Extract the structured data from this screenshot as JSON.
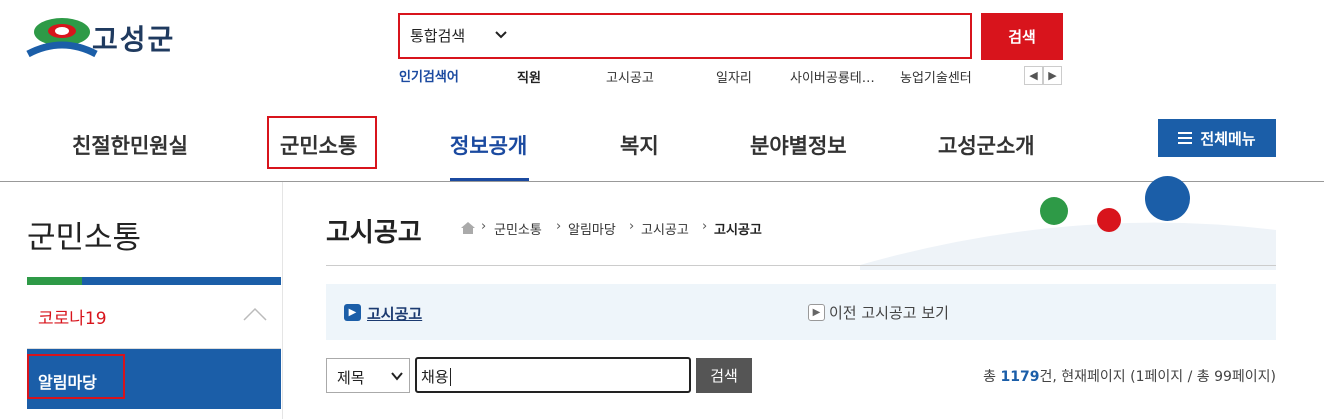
{
  "header": {
    "logo_text": "고성군",
    "search": {
      "scope": "통합검색",
      "button": "검색"
    },
    "popular": {
      "label": "인기검색어",
      "items": [
        "직원",
        "고시공고",
        "일자리",
        "사이버공룡테…",
        "농업기술센터"
      ]
    }
  },
  "nav": {
    "items": [
      "친절한민원실",
      "군민소통",
      "정보공개",
      "복지",
      "분야별정보",
      "고성군소개"
    ],
    "all_menu": "전체메뉴"
  },
  "sidebar": {
    "title": "군민소통",
    "items": [
      {
        "label": "코로나19"
      },
      {
        "label": "알림마당"
      }
    ]
  },
  "content": {
    "page_title": "고시공고",
    "breadcrumb": [
      "군민소통",
      "알림마당",
      "고시공고",
      "고시공고"
    ],
    "notice": {
      "link": "고시공고",
      "prev": "이전 고시공고 보기"
    },
    "filter": {
      "field": "제목",
      "keyword": "채용",
      "button": "검색"
    },
    "total": {
      "prefix": "총 ",
      "count": "1179",
      "suffix": "건, 현재페이지 (1페이지 / 총 99페이지)"
    }
  },
  "colors": {
    "brand_red": "#d8141c",
    "brand_blue": "#1b5ea8",
    "brand_green": "#2e9a47"
  }
}
